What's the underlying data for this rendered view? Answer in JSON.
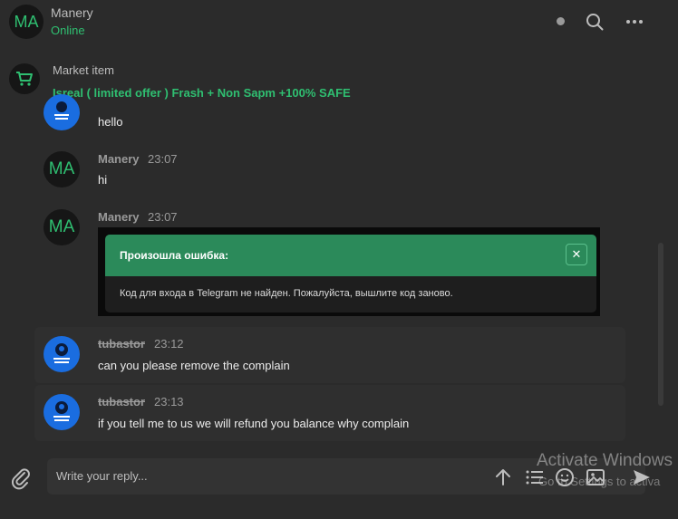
{
  "header": {
    "avatar_initials": "MA",
    "name": "Manery",
    "status": "Online"
  },
  "market": {
    "label": "Market item",
    "title": "Isreal ( limited offer ) Frash + Non Sapm +100% SAFE"
  },
  "messages": [
    {
      "text": "hello"
    },
    {
      "avatar": "MA",
      "author": "Manery",
      "time": "23:07",
      "text": "hi"
    },
    {
      "avatar": "MA",
      "author": "Manery",
      "time": "23:07",
      "attachment": {
        "title": "Произошла ошибка:",
        "body": "Код для входа в Telegram не найден. Пожалуйста, вышлите код заново.",
        "close": "✕"
      }
    },
    {
      "author": "tubastor",
      "time": "23:12",
      "text": "can you please remove the complain"
    },
    {
      "author": "tubastor",
      "time": "23:13",
      "text": "if you tell me to us we will refund you balance why complain"
    }
  ],
  "composer": {
    "placeholder": "Write your reply..."
  },
  "watermark": {
    "line1": "Activate Windows",
    "line2": "Go to Settings to activa"
  },
  "colors": {
    "accent": "#2fbf71",
    "background": "#2b2b2b",
    "error_header": "#2b8a5a",
    "avatar_blue": "#1a6de0"
  }
}
